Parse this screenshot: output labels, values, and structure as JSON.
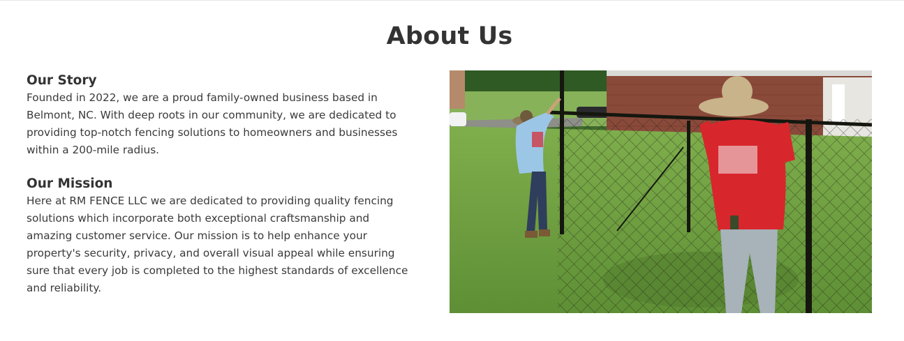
{
  "about": {
    "title": "About Us",
    "story": {
      "heading": "Our Story",
      "body": "Founded in 2022, we are a proud family-owned business based in Belmont, NC. With deep roots in our community, we are dedicated to providing top-notch fencing solutions to homeowners and businesses within a 200-mile radius."
    },
    "mission": {
      "heading": "Our Mission",
      "body": "Here at RM FENCE LLC we are dedicated to providing quality fencing solutions which incorporate both exceptional craftsmanship and amazing customer service. Our mission is to help enhance your property's security, privacy, and overall visual appeal while ensuring sure that every job is completed to the highest standards of excellence and reliability."
    },
    "photo": {
      "alt": "Two workers installing a black chain-link fence on a grassy lawn"
    }
  },
  "colors": {
    "heading": "#333333",
    "body_text": "#3a3a3a",
    "grass": "#6a9a3e",
    "brick": "#8a4a3a",
    "shirt_red": "#d8262d",
    "shirt_blue": "#9cc6e6"
  }
}
